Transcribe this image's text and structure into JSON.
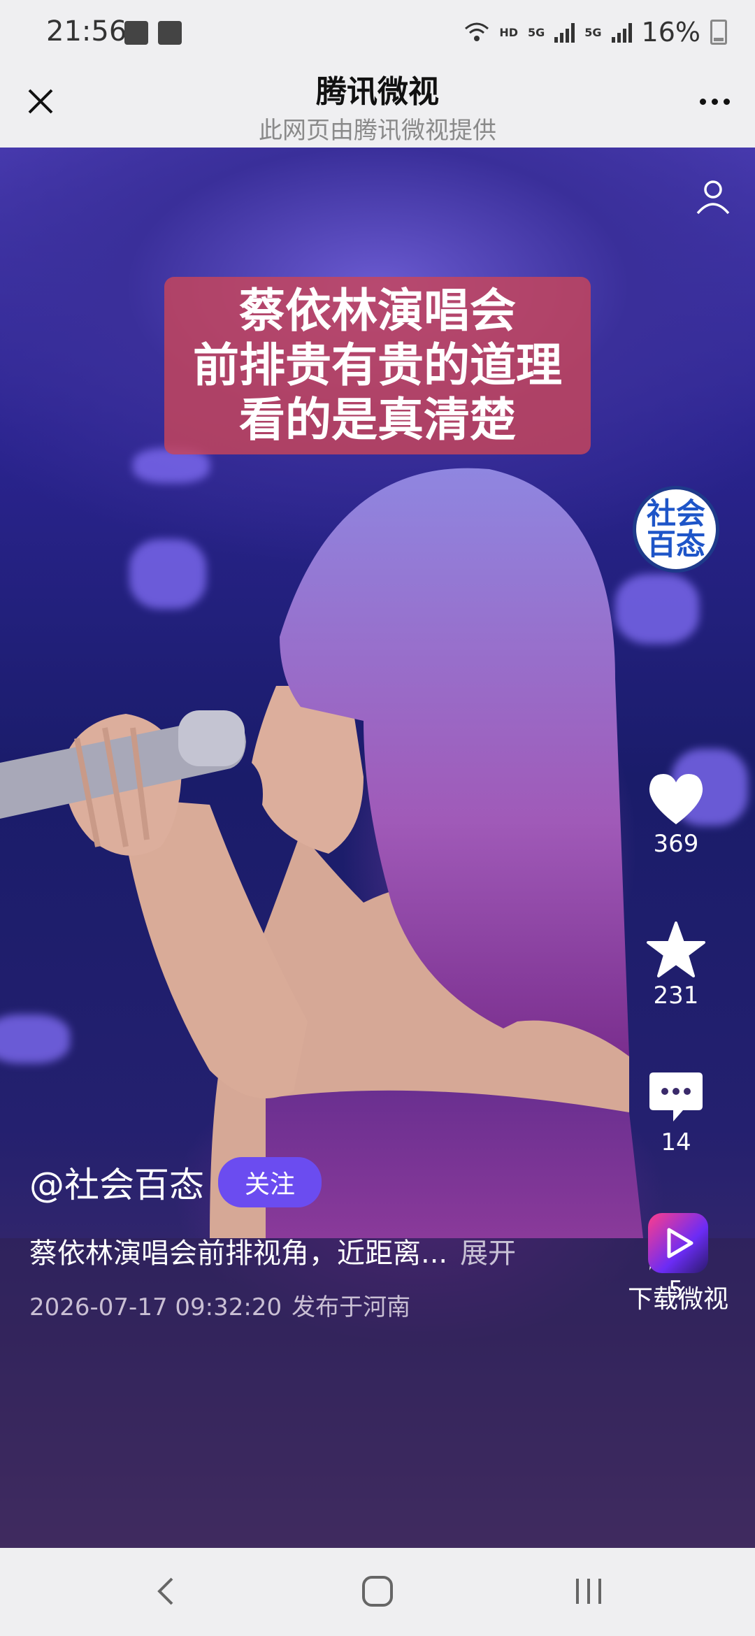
{
  "status_bar": {
    "time": "21:56",
    "network": "HD",
    "signal_1": "5G",
    "signal_2": "5G",
    "battery": "16%"
  },
  "header": {
    "title": "腾讯微视",
    "subtitle": "此网页由腾讯微视提供"
  },
  "video": {
    "caption_lines": [
      "蔡依林演唱会",
      "前排贵有贵的道理",
      "看的是真清楚"
    ]
  },
  "side_rail": {
    "avatar_lines": [
      "社会",
      "百态"
    ],
    "likes": "369",
    "favorites": "231",
    "comments": "14",
    "shares": "5",
    "download_label": "下载微视"
  },
  "post": {
    "author": "@社会百态",
    "follow_label": "关注",
    "description": "蔡依林演唱会前排视角，近距离...",
    "expand_label": "展开",
    "timestamp": "2026-07-17 09:32:20",
    "location": "发布于河南"
  },
  "icons": [
    "close-icon",
    "more-icon",
    "user-icon",
    "heart-icon",
    "star-icon",
    "comment-icon",
    "share-icon",
    "weishi-logo-icon",
    "back-icon",
    "home-icon",
    "recents-icon"
  ],
  "colors": {
    "follow_button": "#6b4cf0",
    "caption_bg": "#c8465a",
    "avatar_border": "#1e3a8a"
  }
}
